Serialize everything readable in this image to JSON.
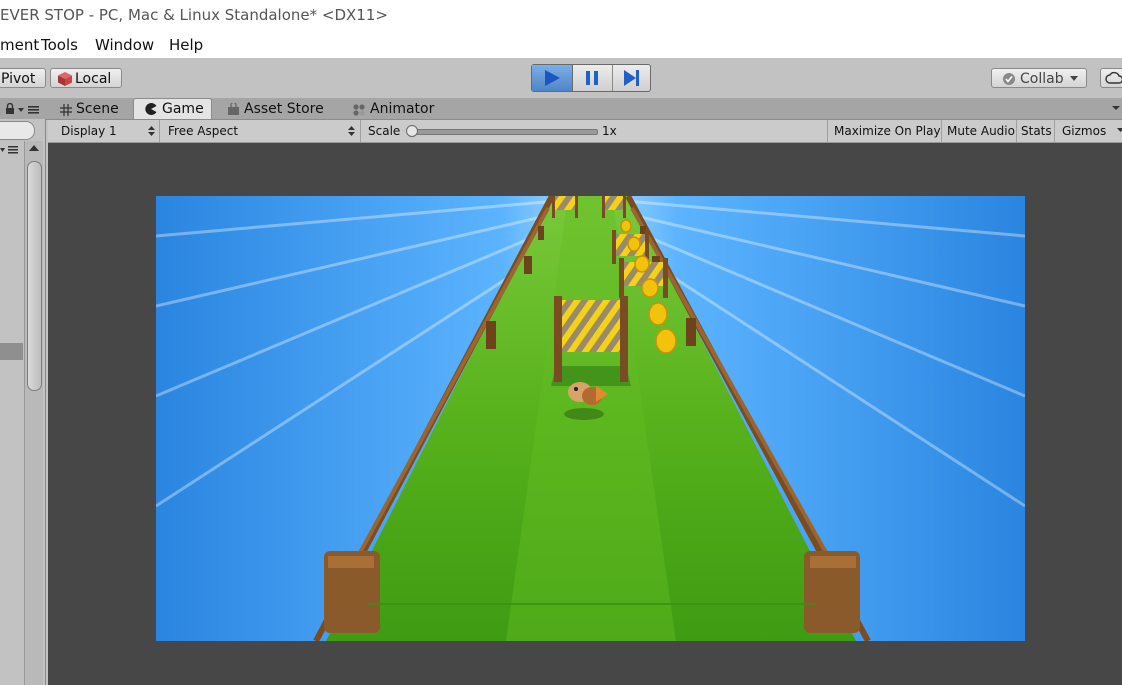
{
  "window": {
    "title": "EVER STOP - PC, Mac & Linux Standalone* <DX11>"
  },
  "menu": {
    "items": [
      "ment",
      "Tools",
      "Window",
      "Help"
    ]
  },
  "toolbar": {
    "pivot_label": "Pivot",
    "local_label": "Local",
    "collab_label": "Collab",
    "play_active": true,
    "colors": {
      "play_active": "#2e7bd6",
      "icons": "#2160c4"
    }
  },
  "tabs": [
    {
      "label": "Scene",
      "icon": "grid-icon",
      "active": false
    },
    {
      "label": "Game",
      "icon": "pacman-icon",
      "active": true
    },
    {
      "label": "Asset Store",
      "icon": "bag-icon",
      "active": false
    },
    {
      "label": "Animator",
      "icon": "animator-icon",
      "active": false
    }
  ],
  "game_toolbar": {
    "display": "Display 1",
    "aspect": "Free Aspect",
    "scale_label": "Scale",
    "scale_value": "1x",
    "scale_level": 0,
    "maximize_on_play": "Maximize On Play",
    "mute_audio": "Mute Audio",
    "stats": "Stats",
    "gizmos": "Gizmos"
  },
  "colors": {
    "sky": "#2f8fe6",
    "grass": "#4faf1a",
    "fence_wood": "#8a5a2b",
    "barrier_stripe": "#f4d21a",
    "coin": "#f2c20d",
    "view_bg": "#474747"
  }
}
